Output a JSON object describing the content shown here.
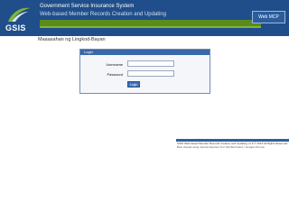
{
  "header": {
    "logo_text": "GSIS",
    "system_title": "Government Service Insurance System",
    "system_subtitle": "Web-based Member Records Creation and Updating",
    "version_label": "Web MCP"
  },
  "tagline": "Maaasahan ng Lingkod-Bayan",
  "login": {
    "title": "Login",
    "username_label": "Username",
    "password_label": "Password",
    "submit_label": "Login",
    "username_value": "",
    "password_value": ""
  },
  "footer": {
    "line1": "GSIS Web-based Member Records Creation and Updating v1.0 © 2013 All Rights Reserved.",
    "line2": "Best viewed using Internet Explorer 8 or Mozilla Firefox / Google Chrome"
  },
  "colors": {
    "header_bg": "#1f4e8a",
    "green_band": "#5b8a1d",
    "panel_head": "#3a67a8"
  }
}
